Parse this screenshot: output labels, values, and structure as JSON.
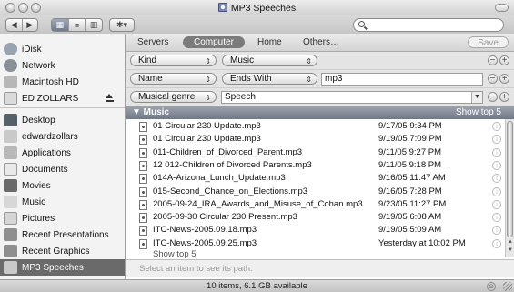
{
  "window": {
    "title": "MP3 Speeches"
  },
  "toolbar": {
    "back_glyph": "◀",
    "forward_glyph": "▶",
    "view_icons": [
      "▦",
      "≡",
      "▥"
    ],
    "action_glyph": "✱▾"
  },
  "sidebar": {
    "devices": [
      {
        "label": "iDisk",
        "icon": "idisk-icon",
        "color": "#9aa3b0"
      },
      {
        "label": "Network",
        "icon": "network-icon",
        "color": "#8b8f98"
      },
      {
        "label": "Macintosh HD",
        "icon": "hard-drive-icon",
        "color": "#b7b7b7"
      },
      {
        "label": "ED ZOLLARS",
        "icon": "usb-drive-icon",
        "color": "#dadada"
      }
    ],
    "places": [
      {
        "label": "Desktop",
        "icon": "desktop-icon",
        "color": "#55606b"
      },
      {
        "label": "edwardzollars",
        "icon": "home-icon",
        "color": "#c9c9c9"
      },
      {
        "label": "Applications",
        "icon": "applications-icon",
        "color": "#b9b9b9"
      },
      {
        "label": "Documents",
        "icon": "documents-icon",
        "color": "#e9e9e9"
      },
      {
        "label": "Movies",
        "icon": "movies-icon",
        "color": "#6a6a6a"
      },
      {
        "label": "Music",
        "icon": "music-icon",
        "color": "#d7d7d7"
      },
      {
        "label": "Pictures",
        "icon": "pictures-icon",
        "color": "#d6d6d6"
      },
      {
        "label": "Recent Presentations",
        "icon": "smart-folder-icon",
        "color": "#8f8f8f"
      },
      {
        "label": "Recent Graphics",
        "icon": "smart-folder-icon",
        "color": "#8f8f8f"
      },
      {
        "label": "MP3 Speeches",
        "icon": "smart-folder-icon",
        "color": "#8f8f8f"
      }
    ]
  },
  "scope": {
    "servers": "Servers",
    "computer": "Computer",
    "home": "Home",
    "others": "Others…",
    "save": "Save"
  },
  "criteria": [
    {
      "attribute": "Kind",
      "operator": "Music",
      "value": ""
    },
    {
      "attribute": "Name",
      "operator": "Ends With",
      "value": "mp3"
    },
    {
      "attribute": "Musical genre",
      "operator": "",
      "value": "Speech"
    }
  ],
  "results": {
    "group_label": "▼ Music",
    "show_top_label": "Show top 5",
    "items": [
      {
        "name": "01 Circular 230 Update.mp3",
        "date": "9/17/05 9:34 PM"
      },
      {
        "name": "01 Circular 230 Update.mp3",
        "date": "9/19/05 7:09 PM"
      },
      {
        "name": "011-Children_of_Divorced_Parent.mp3",
        "date": "9/11/05 9:27 PM"
      },
      {
        "name": "12 012-Children of Divorced Parents.mp3",
        "date": "9/11/05 9:18 PM"
      },
      {
        "name": "014A-Arizona_Lunch_Update.mp3",
        "date": "9/16/05 11:47 AM"
      },
      {
        "name": "015-Second_Chance_on_Elections.mp3",
        "date": "9/16/05 7:28 PM"
      },
      {
        "name": "2005-09-24_IRA_Awards_and_Misuse_of_Cohan.mp3",
        "date": "9/23/05 11:27 PM"
      },
      {
        "name": "2005-09-30 Circular 230 Present.mp3",
        "date": "9/19/05 6:08 AM"
      },
      {
        "name": "ITC-News-2005.09.18.mp3",
        "date": "9/19/05 5:09 AM"
      },
      {
        "name": "ITC-News-2005.09.25.mp3",
        "date": "Yesterday at 10:02 PM"
      }
    ],
    "footer_show_top": "Show top 5"
  },
  "path_hint": "Select an item to see its path.",
  "status": "10 items, 6.1 GB available"
}
